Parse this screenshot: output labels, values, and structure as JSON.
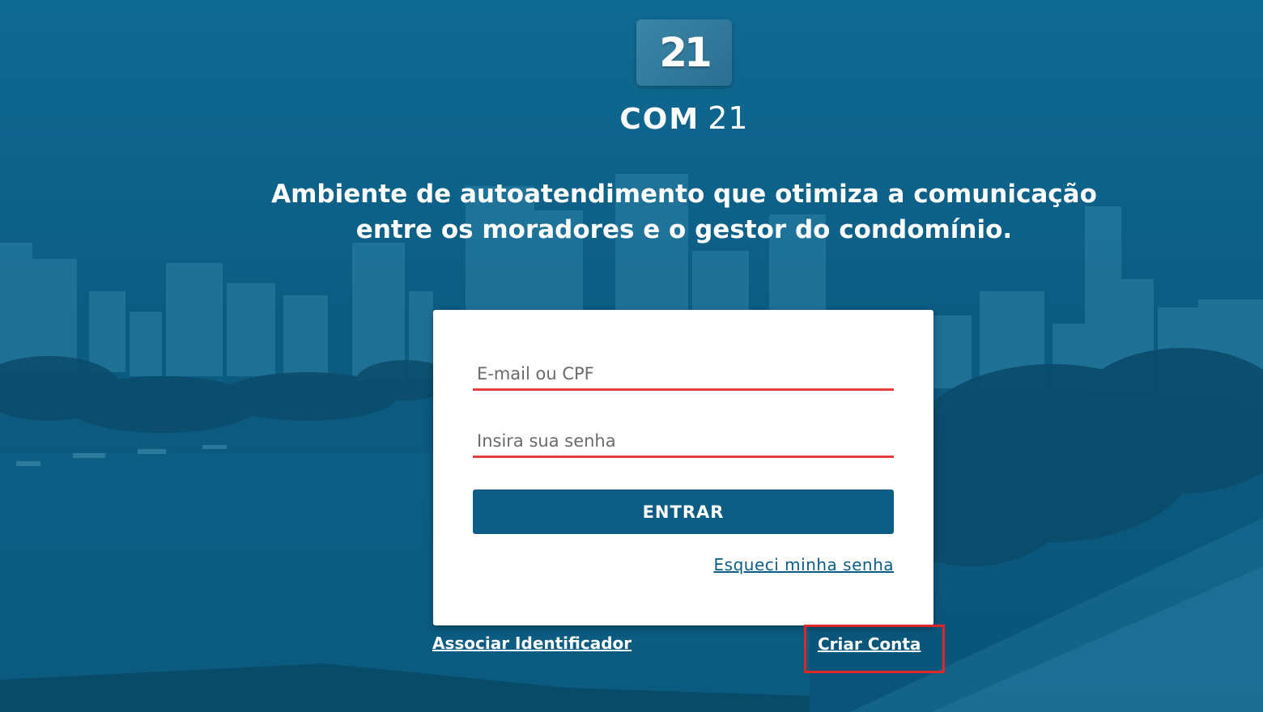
{
  "logo": {
    "tile_text": "21",
    "brand_bold": "COM",
    "brand_light": "21"
  },
  "tagline": {
    "line1": "Ambiente de autoatendimento que otimiza a comunicação",
    "line2": "entre os moradores e o gestor do condomínio."
  },
  "login": {
    "email_placeholder": "E-mail ou CPF",
    "password_placeholder": "Insira sua senha",
    "submit_label": "ENTRAR",
    "forgot_label": "Esqueci minha senha"
  },
  "footer_links": {
    "associate_label": "Associar Identificador",
    "create_account_label": "Criar Conta"
  },
  "colors": {
    "background": "#0d5e84",
    "button": "#0c5c86",
    "field_underline": "#e43d3d",
    "highlight_box": "#e02626"
  }
}
